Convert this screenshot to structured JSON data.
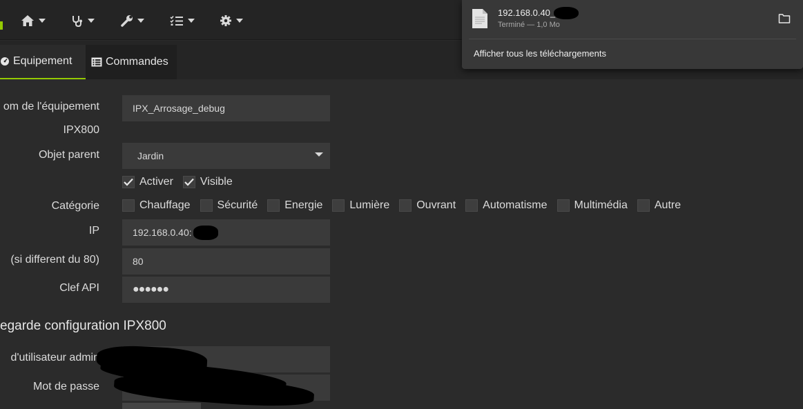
{
  "navbar": {
    "items": [
      {
        "icon": "home-icon"
      },
      {
        "icon": "stethoscope-icon"
      },
      {
        "icon": "wrench-icon"
      },
      {
        "icon": "list-check-icon"
      },
      {
        "icon": "gear-icon"
      }
    ],
    "accent_color": "#94ca02"
  },
  "tabs": {
    "equipment": "Equipement",
    "commands": "Commandes"
  },
  "form": {
    "name_label": "om de l'équipement",
    "name_value": "IPX_Arrosage_debug",
    "device_label": "IPX800",
    "parent_label": "Objet parent",
    "parent_value": "Jardin",
    "activate_label": "Activer",
    "visible_label": "Visible",
    "category_label": "Catégorie",
    "categories": [
      "Chauffage",
      "Sécurité",
      "Energie",
      "Lumière",
      "Ouvrant",
      "Automatisme",
      "Multimédia",
      "Autre"
    ],
    "ip_label": "IP",
    "ip_value": "192.168.0.40:",
    "port_label": "(si different du 80)",
    "port_value": "80",
    "apikey_label": "Clef API",
    "apikey_value": "●●●●●●",
    "backup_title": "egarde configuration IPX800",
    "admin_user_label": "d'utilisateur admin",
    "password_label": "Mot de passe"
  },
  "downloads": {
    "file_name": "192.168.0.40_        .gce",
    "file_status": "Terminé — 1,0 Mo",
    "show_all": "Afficher tous les téléchargements"
  }
}
